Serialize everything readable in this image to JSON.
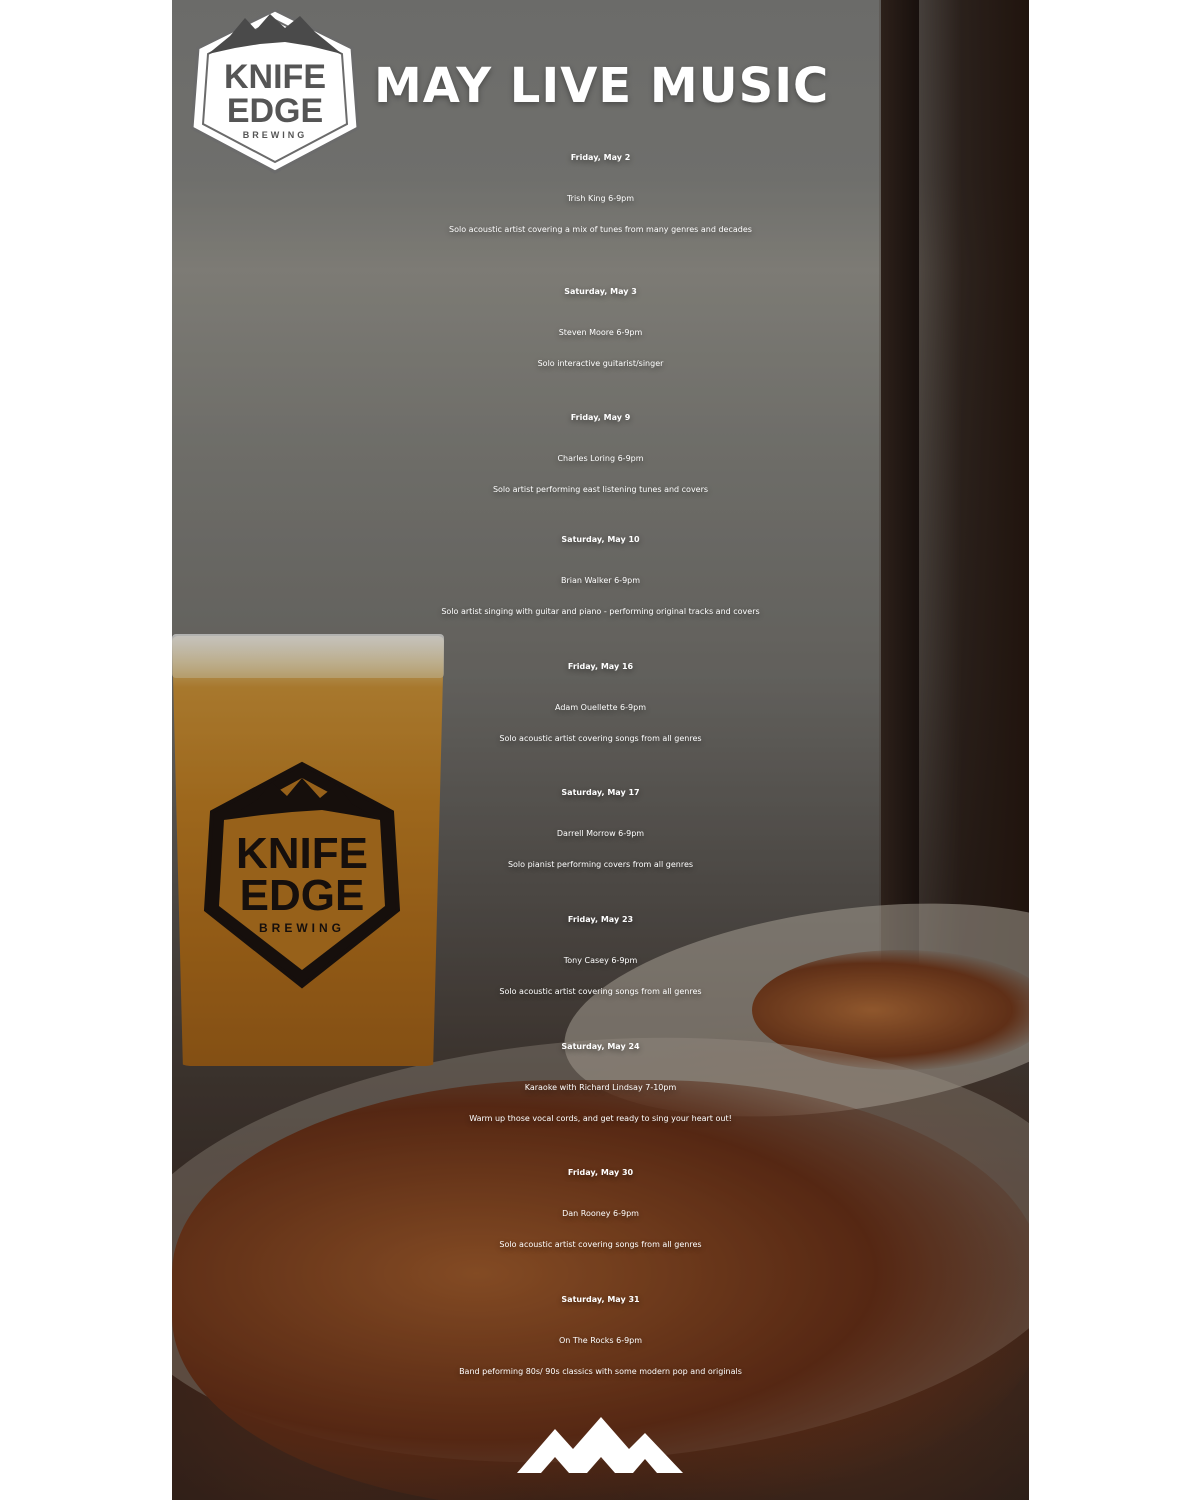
{
  "header": {
    "logo_text_line1": "KNIFE",
    "logo_text_line2": "EDGE",
    "logo_text_line3": "BREWING",
    "title": "MAY LIVE MUSIC"
  },
  "events": [
    {
      "date": "Friday, May 2",
      "act": "Trish King 6-9pm",
      "desc": "Solo acoustic artist covering a mix of tunes from many genres and decades"
    },
    {
      "date": "Saturday, May 3",
      "act": "Steven Moore 6-9pm",
      "desc": "Solo interactive guitarist/singer"
    },
    {
      "date": "Friday, May 9",
      "act": "Charles Loring 6-9pm",
      "desc": "Solo artist performing east listening tunes and covers"
    },
    {
      "date": "Saturday, May 10",
      "act": "Brian Walker 6-9pm",
      "desc": "Solo artist singing with guitar and piano - performing original tracks and covers"
    },
    {
      "date": "Friday, May 16",
      "act": "Adam Ouellette 6-9pm",
      "desc": "Solo acoustic artist covering songs from all genres"
    },
    {
      "date": "Saturday, May 17",
      "act": "Darrell Morrow 6-9pm",
      "desc": "Solo pianist performing covers from all genres"
    },
    {
      "date": "Friday, May 23",
      "act": "Tony Casey 6-9pm",
      "desc": "Solo acoustic artist covering songs from all genres"
    },
    {
      "date": "Saturday, May 24",
      "act": "Karaoke with Richard Lindsay 7-10pm",
      "desc": "Warm up those vocal cords, and get ready to sing your heart out!"
    },
    {
      "date": "Friday, May 30",
      "act": "Dan Rooney 6-9pm",
      "desc": "Solo acoustic artist covering songs from all genres"
    },
    {
      "date": "Saturday, May 31",
      "act": "On The Rocks 6-9pm",
      "desc": "Band peforming 80s/ 90s classics with some modern pop and originals"
    }
  ],
  "icons": {
    "brand_logo": "knife-edge-mountain-hexagon-logo",
    "footer_logo": "mountain-peaks-icon"
  },
  "colors": {
    "text": "#ffffff",
    "beer": "#c98424"
  }
}
